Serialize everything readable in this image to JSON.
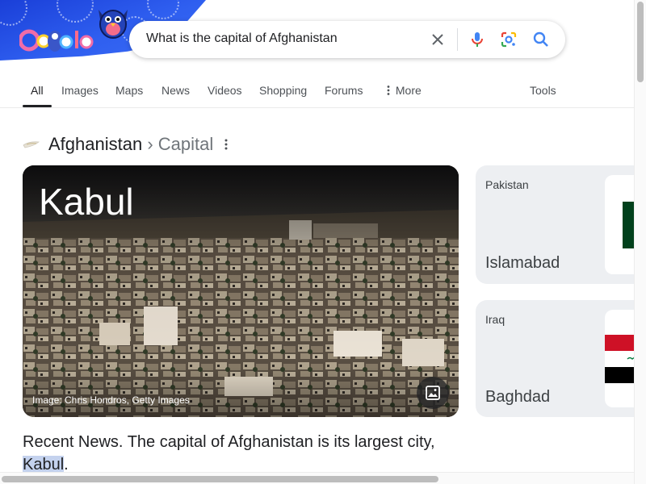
{
  "search": {
    "query": "What is the capital of Afghanistan"
  },
  "tabs": [
    {
      "label": "All",
      "active": true
    },
    {
      "label": "Images"
    },
    {
      "label": "Maps"
    },
    {
      "label": "News"
    },
    {
      "label": "Videos"
    },
    {
      "label": "Shopping"
    },
    {
      "label": "Forums"
    },
    {
      "label": "More",
      "icon": "vertical-dots-icon"
    },
    {
      "label": "Tools"
    }
  ],
  "knowledge": {
    "entity": "Afghanistan",
    "separator": "›",
    "attribute": "Capital",
    "answer": "Kabul",
    "image_credit": "Image: Chris Hondros, Getty Images"
  },
  "related": [
    {
      "country": "Pakistan",
      "capital": "Islamabad"
    },
    {
      "country": "Iraq",
      "capital": "Baghdad"
    }
  ],
  "snippet": {
    "text": "Recent News. The capital of Afghanistan is its largest city, ",
    "highlight": "Kabul",
    "end": "."
  },
  "colors": {
    "doodle_blue": "#2f5ff0",
    "mic_blue": "#4285f4",
    "mic_red": "#ea4335",
    "lens_yellow": "#fbbc04",
    "lens_green": "#34a853",
    "card_bg": "#edeff2",
    "highlight": "#c4d2ee"
  }
}
